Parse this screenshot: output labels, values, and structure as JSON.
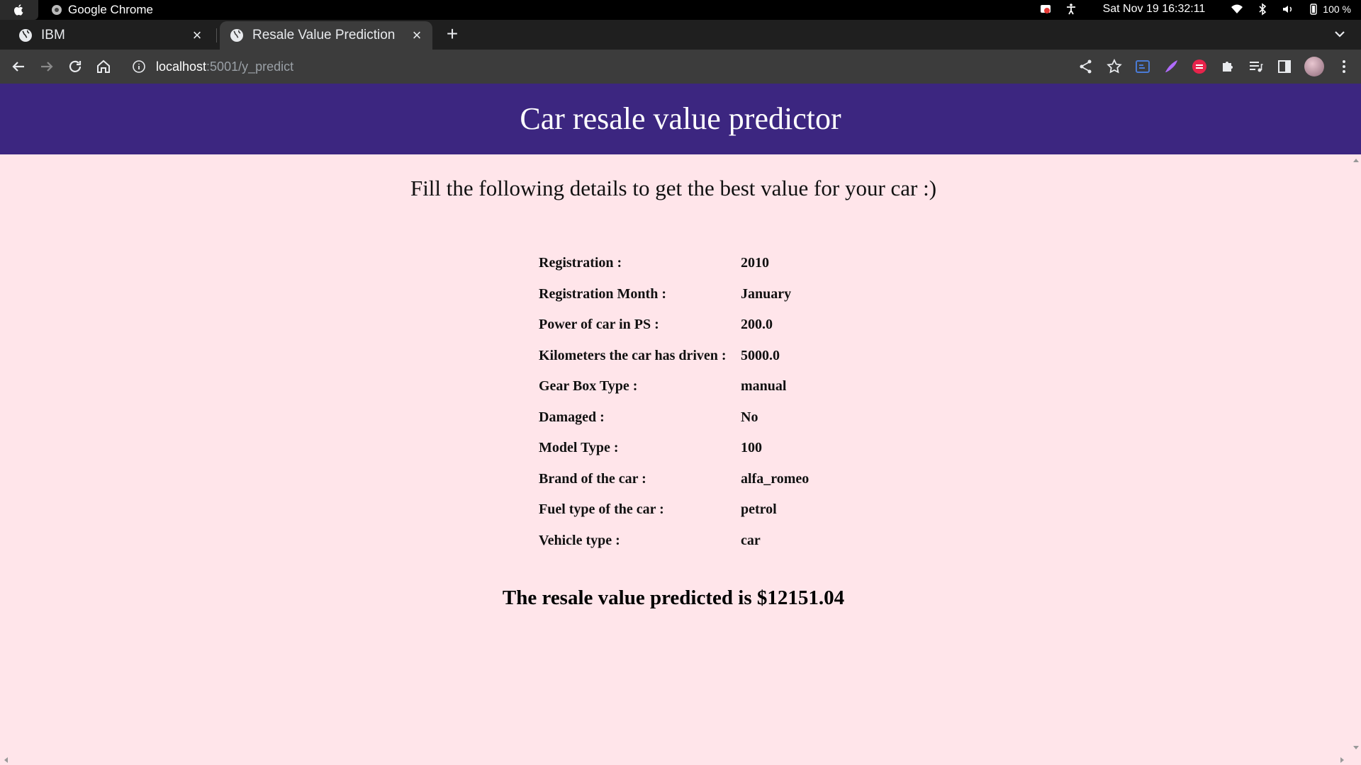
{
  "os": {
    "app_name": "Google Chrome",
    "datetime": "Sat Nov 19  16:32:11",
    "battery": "100 %"
  },
  "browser": {
    "tabs": [
      {
        "label": "IBM"
      },
      {
        "label": "Resale Value Prediction"
      }
    ],
    "url_host": "localhost",
    "url_path": ":5001/y_predict"
  },
  "page": {
    "header_title": "Car resale value predictor",
    "subtitle": "Fill the following details to get the best value for your car :)",
    "details": [
      {
        "label": "Registration :",
        "value": "2010"
      },
      {
        "label": "Registration Month :",
        "value": "January"
      },
      {
        "label": "Power of car in PS :",
        "value": "200.0"
      },
      {
        "label": "Kilometers the car has driven :",
        "value": "5000.0"
      },
      {
        "label": "Gear Box Type :",
        "value": "manual"
      },
      {
        "label": "Damaged :",
        "value": "No"
      },
      {
        "label": "Model Type :",
        "value": "100"
      },
      {
        "label": "Brand of the car :",
        "value": "alfa_romeo"
      },
      {
        "label": "Fuel type of the car :",
        "value": "petrol"
      },
      {
        "label": "Vehicle type :",
        "value": "car"
      }
    ],
    "result": "The resale value predicted is $12151.04"
  },
  "colors": {
    "header_bg": "#3c2680",
    "page_bg": "#ffe5ea",
    "tab_active_bg": "#3c3c3c",
    "tabstrip_bg": "#1f1f1f"
  }
}
